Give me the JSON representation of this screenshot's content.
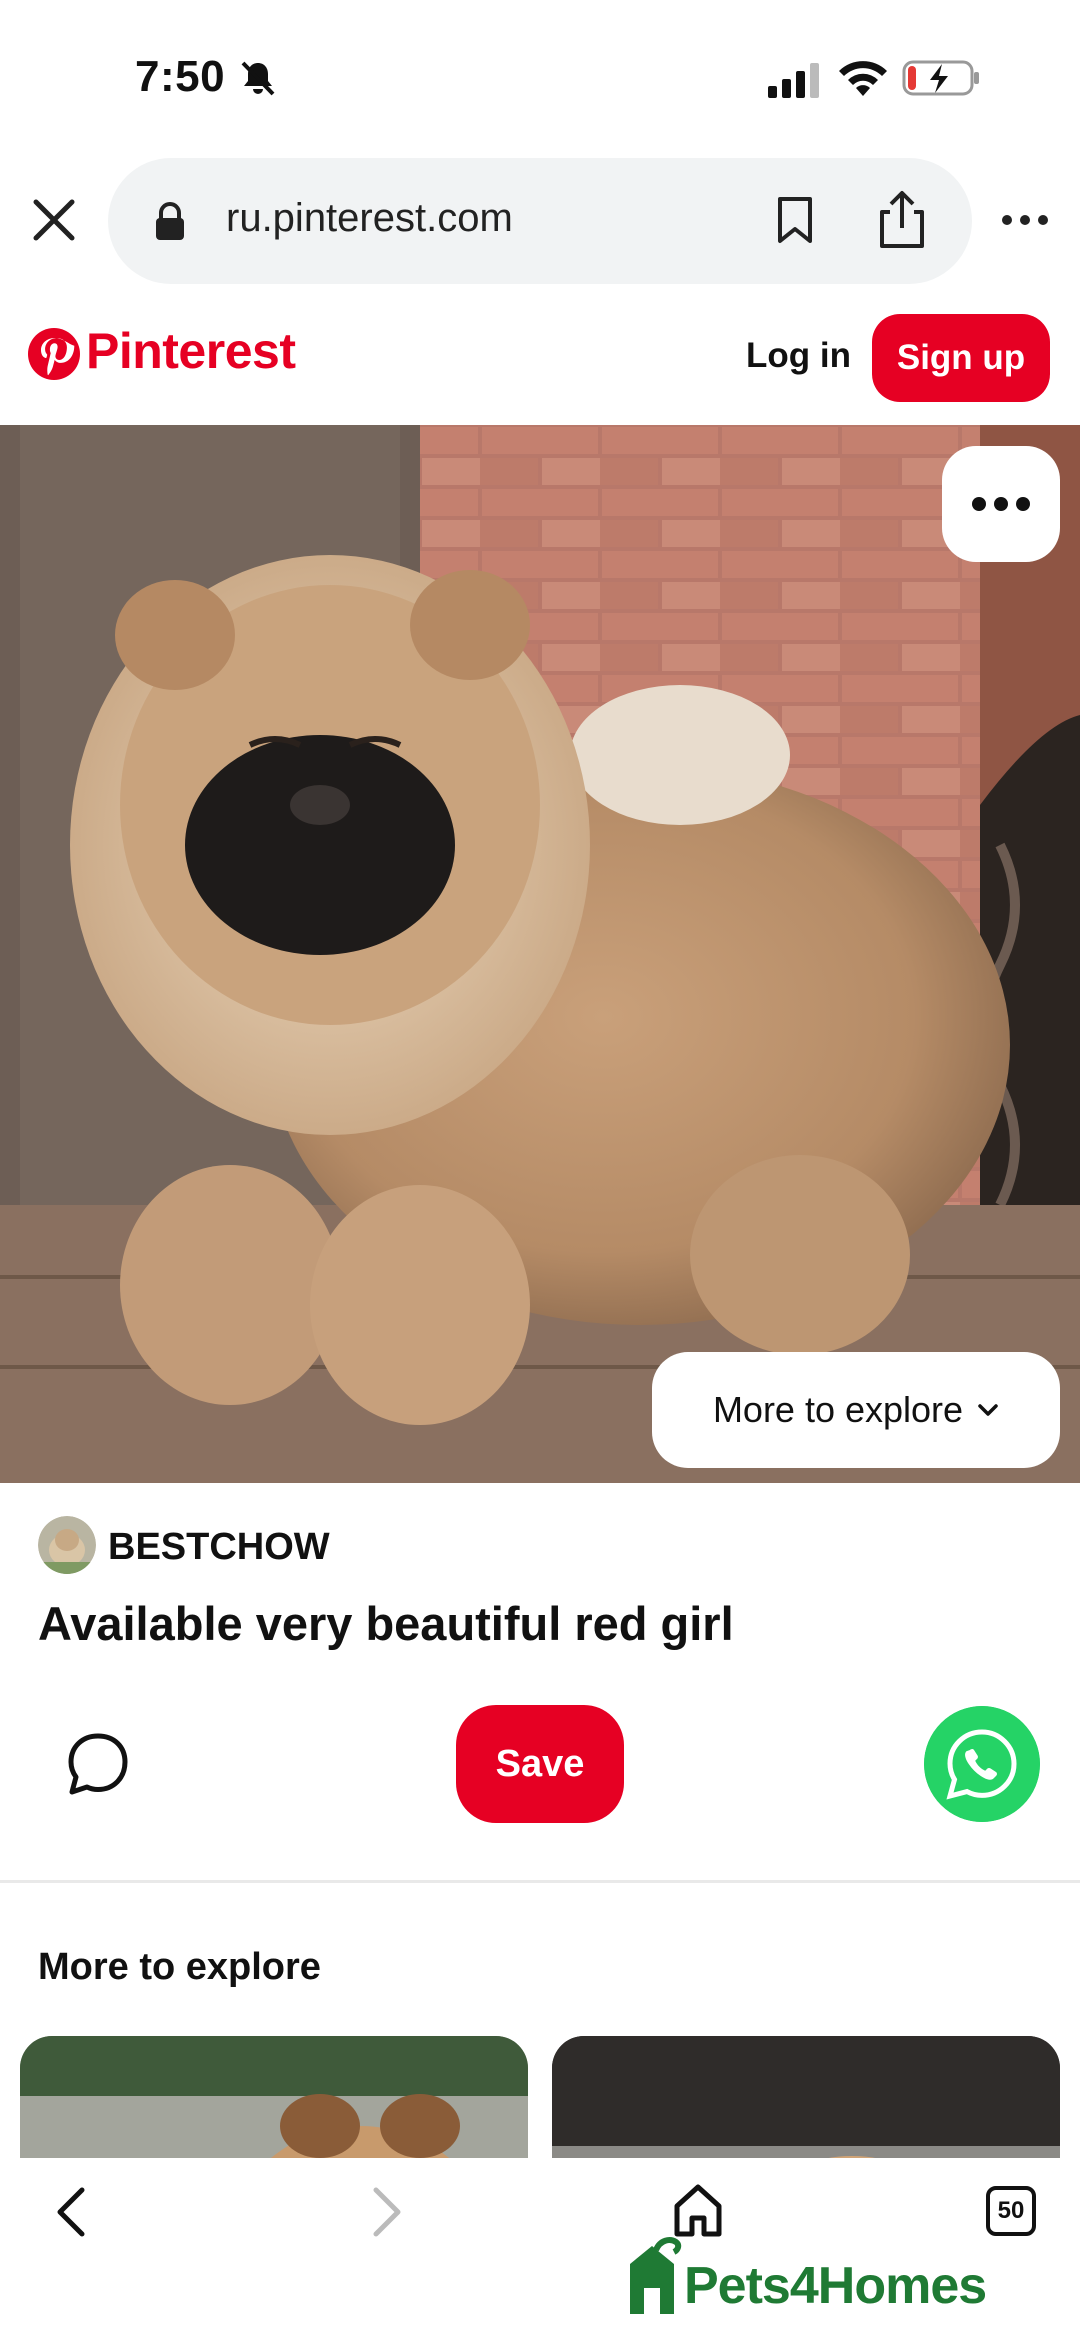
{
  "status_bar": {
    "time": "7:50"
  },
  "browser": {
    "url": "ru.pinterest.com"
  },
  "header": {
    "brand": "Pinterest",
    "login_label": "Log in",
    "signup_label": "Sign up"
  },
  "hero": {
    "explore_label": "More to explore"
  },
  "pin": {
    "author": "BESTCHOW",
    "title": "Available very beautiful red girl",
    "save_label": "Save"
  },
  "section": {
    "title": "More to explore"
  },
  "bottom_bar": {
    "tabs_count": "50",
    "watermark": "Pets4Homes"
  },
  "colors": {
    "brand_red": "#e60023",
    "whatsapp_green": "#25d366",
    "watermark_green": "#1f7a34"
  }
}
